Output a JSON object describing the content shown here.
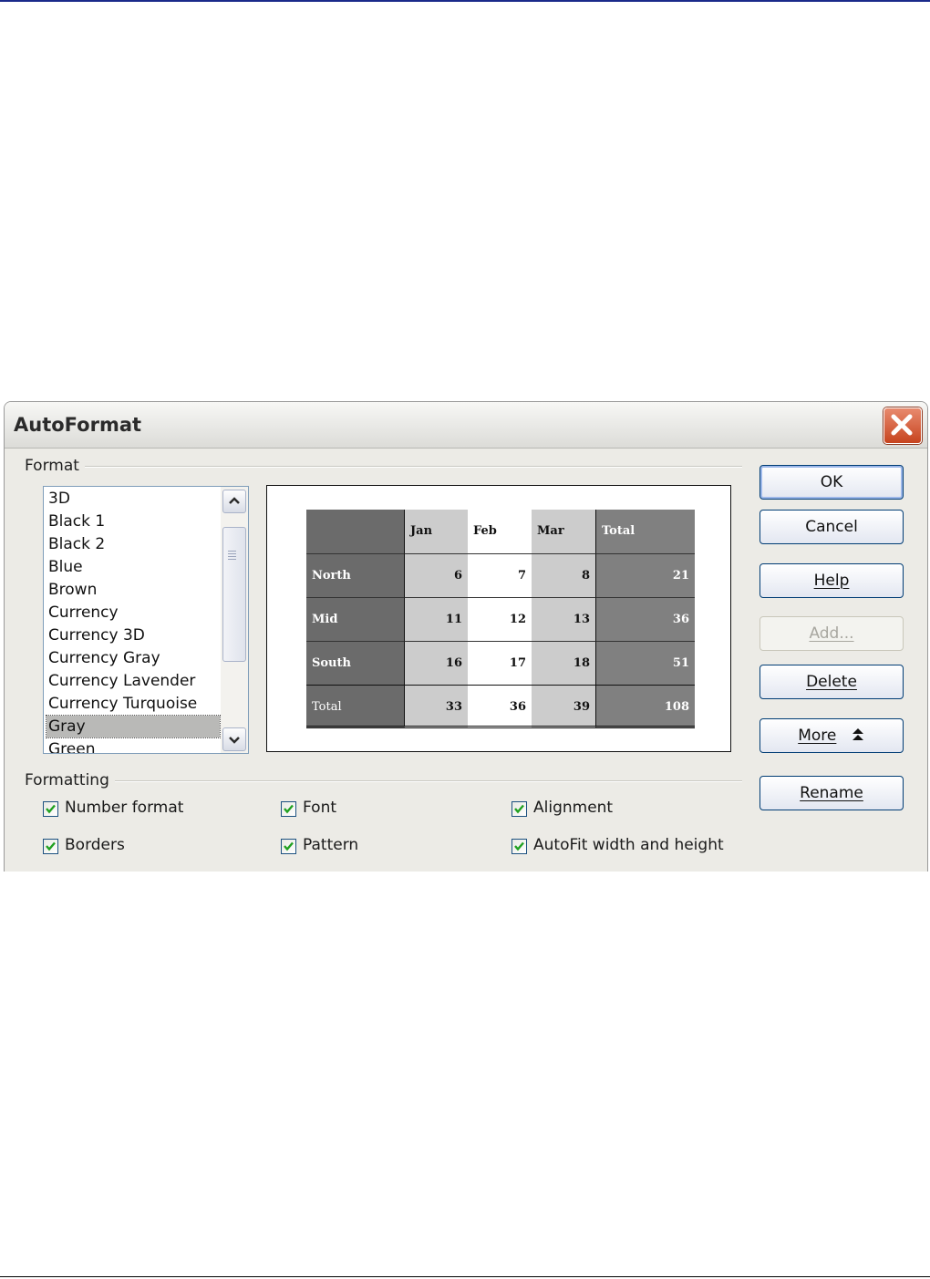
{
  "dialog": {
    "title": "AutoFormat",
    "format_label": "Format",
    "formatting_label": "Formatting"
  },
  "format_list": {
    "items": [
      "3D",
      "Black 1",
      "Black 2",
      "Blue",
      "Brown",
      "Currency",
      "Currency 3D",
      "Currency Gray",
      "Currency Lavender",
      "Currency Turquoise",
      "Gray",
      "Green"
    ],
    "selected": "Gray"
  },
  "preview": {
    "col_headers": [
      "Jan",
      "Feb",
      "Mar",
      "Total"
    ],
    "rows": [
      {
        "label": "North",
        "values": [
          "6",
          "7",
          "8",
          "21"
        ]
      },
      {
        "label": "Mid",
        "values": [
          "11",
          "12",
          "13",
          "36"
        ]
      },
      {
        "label": "South",
        "values": [
          "16",
          "17",
          "18",
          "51"
        ]
      },
      {
        "label": "Total",
        "values": [
          "33",
          "36",
          "39",
          "108"
        ]
      }
    ],
    "colors": {
      "dark": "#6b6b6b",
      "light": "#cccccc",
      "white": "#ffffff",
      "total_col": "#808080"
    }
  },
  "buttons": {
    "ok": "OK",
    "cancel": "Cancel",
    "help": "Help",
    "add": "Add...",
    "delete": "Delete",
    "more": "More",
    "rename": "Rename"
  },
  "options": {
    "number_format": {
      "label": "Number format",
      "checked": true
    },
    "font": {
      "label": "Font",
      "checked": true
    },
    "alignment": {
      "label": "Alignment",
      "checked": true
    },
    "borders": {
      "label": "Borders",
      "checked": true
    },
    "pattern": {
      "label": "Pattern",
      "checked": true
    },
    "autofit": {
      "label": "AutoFit width and height",
      "checked": true
    }
  }
}
